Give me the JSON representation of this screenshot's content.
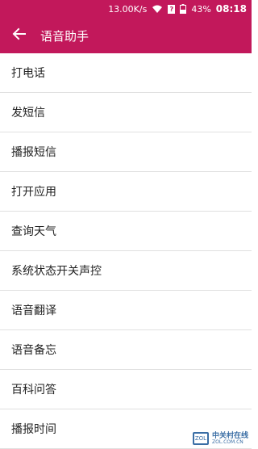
{
  "status_bar": {
    "net_speed": "13.00K/s",
    "sim_badge": "?",
    "battery": "43%",
    "time": "08:18"
  },
  "appbar": {
    "title": "语音助手"
  },
  "items": [
    {
      "label": "打电话"
    },
    {
      "label": "发短信"
    },
    {
      "label": "播报短信"
    },
    {
      "label": "打开应用"
    },
    {
      "label": "查询天气"
    },
    {
      "label": "系统状态开关声控"
    },
    {
      "label": "语音翻译"
    },
    {
      "label": "语音备忘"
    },
    {
      "label": "百科问答"
    },
    {
      "label": "播报时间"
    }
  ],
  "watermark": {
    "cn": "中关村在线",
    "en": "ZOL.COM.CN",
    "logo": "ZOL"
  },
  "colors": {
    "primary": "#c2185b"
  }
}
